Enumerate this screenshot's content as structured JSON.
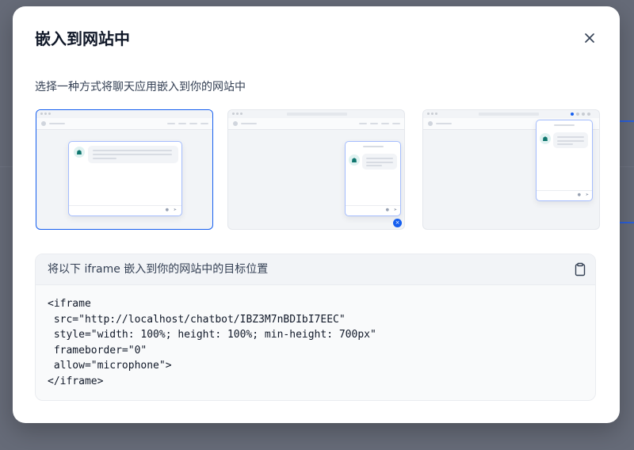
{
  "dialog": {
    "title": "嵌入到网站中",
    "close_icon": "close-icon",
    "subtitle": "选择一种方式将聊天应用嵌入到你的网站中"
  },
  "options": [
    {
      "id": "iframe-fullpage",
      "selected": true
    },
    {
      "id": "floating-bubble",
      "selected": false
    },
    {
      "id": "chrome-extension",
      "selected": false
    }
  ],
  "code_panel": {
    "title": "将以下 iframe 嵌入到你的网站中的目标位置",
    "copy_icon": "clipboard-icon",
    "lines": [
      "<iframe",
      " src=\"http://localhost/chatbot/IBZ3M7nBDIbI7EEC\"",
      " style=\"width: 100%; height: 100%; min-height: 700px\"",
      " frameborder=\"0\"",
      " allow=\"microphone\">",
      "</iframe>"
    ]
  },
  "colors": {
    "accent": "#155eef",
    "overlay": "#5f6472",
    "panel": "#f9fafb"
  }
}
